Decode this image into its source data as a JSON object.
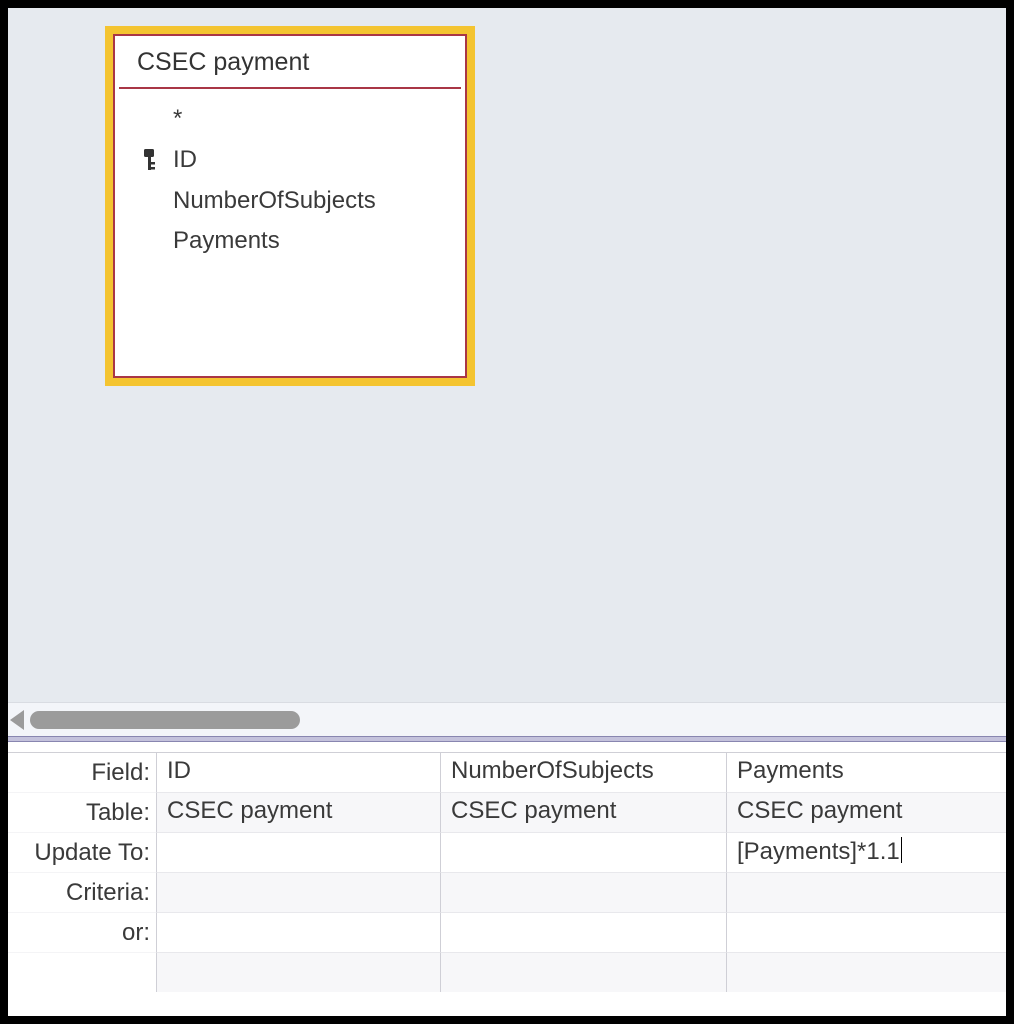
{
  "table": {
    "title": "CSEC payment",
    "fields": [
      "*",
      "ID",
      "NumberOfSubjects",
      "Payments"
    ],
    "primary_key": "ID"
  },
  "grid": {
    "row_labels": [
      "Field:",
      "Table:",
      "Update To:",
      "Criteria:",
      "or:"
    ],
    "columns": [
      {
        "field": "ID",
        "table": "CSEC payment",
        "update_to": "",
        "criteria": "",
        "or": ""
      },
      {
        "field": "NumberOfSubjects",
        "table": "CSEC payment",
        "update_to": "",
        "criteria": "",
        "or": ""
      },
      {
        "field": "Payments",
        "table": "CSEC payment",
        "update_to": "[Payments]*1.1",
        "criteria": "",
        "or": ""
      }
    ],
    "active_cell": {
      "col": 2,
      "row": "update_to"
    }
  }
}
